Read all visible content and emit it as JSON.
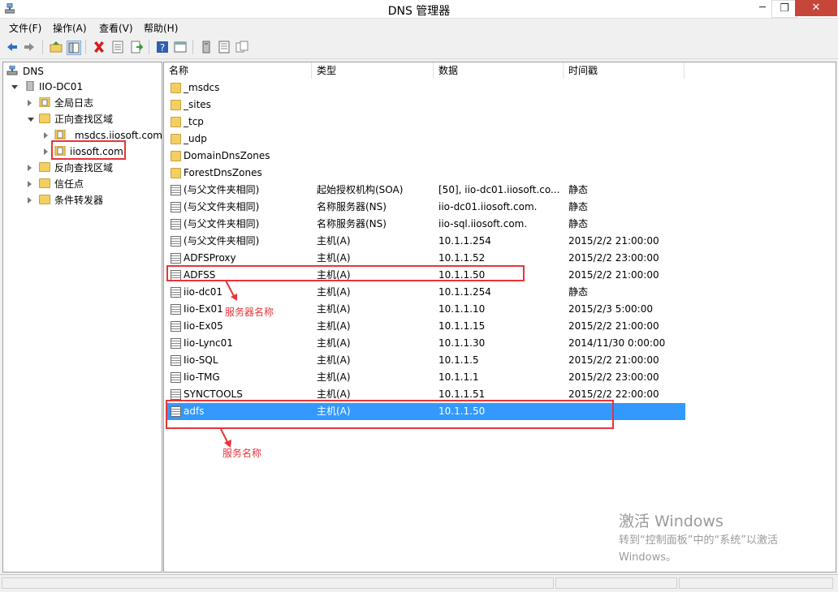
{
  "window": {
    "title": "DNS 管理器",
    "minimize": "─",
    "maximize": "❐",
    "close": "✕"
  },
  "menu": [
    "文件(F)",
    "操作(A)",
    "查看(V)",
    "帮助(H)"
  ],
  "toolbar_icons": [
    "back-icon",
    "forward-icon",
    "up-folder-icon",
    "show-hide-tree-icon",
    "delete-icon",
    "properties-icon",
    "export-icon",
    "help-icon",
    "console-icon",
    "server-icon",
    "record-list-icon",
    "copy-icon"
  ],
  "tree": {
    "root": "DNS",
    "server": "IIO-DC01",
    "items": [
      {
        "label": "全局日志",
        "level": 2,
        "expander": "closed"
      },
      {
        "label": "正向查找区域",
        "level": 2,
        "expander": "open"
      },
      {
        "label": "_msdcs.iiosoft.com",
        "level": 3,
        "expander": "closed"
      },
      {
        "label": "iiosoft.com",
        "level": 3,
        "expander": "closed"
      },
      {
        "label": "反向查找区域",
        "level": 2,
        "expander": "closed"
      },
      {
        "label": "信任点",
        "level": 2,
        "expander": "closed"
      },
      {
        "label": "条件转发器",
        "level": 2,
        "expander": "closed"
      }
    ]
  },
  "columns": [
    "名称",
    "类型",
    "数据",
    "时间戳"
  ],
  "rows": [
    {
      "name": "_msdcs",
      "type": "",
      "data": "",
      "timestamp": "",
      "icon": "folder-icon"
    },
    {
      "name": "_sites",
      "type": "",
      "data": "",
      "timestamp": "",
      "icon": "folder-icon"
    },
    {
      "name": "_tcp",
      "type": "",
      "data": "",
      "timestamp": "",
      "icon": "folder-icon"
    },
    {
      "name": "_udp",
      "type": "",
      "data": "",
      "timestamp": "",
      "icon": "folder-icon"
    },
    {
      "name": "DomainDnsZones",
      "type": "",
      "data": "",
      "timestamp": "",
      "icon": "folder-icon"
    },
    {
      "name": "ForestDnsZones",
      "type": "",
      "data": "",
      "timestamp": "",
      "icon": "folder-icon"
    },
    {
      "name": "(与父文件夹相同)",
      "type": "起始授权机构(SOA)",
      "data": "[50], iio-dc01.iiosoft.co...",
      "timestamp": "静态",
      "icon": "record-icon"
    },
    {
      "name": "(与父文件夹相同)",
      "type": "名称服务器(NS)",
      "data": "iio-dc01.iiosoft.com.",
      "timestamp": "静态",
      "icon": "record-icon"
    },
    {
      "name": "(与父文件夹相同)",
      "type": "名称服务器(NS)",
      "data": "iio-sql.iiosoft.com.",
      "timestamp": "静态",
      "icon": "record-icon"
    },
    {
      "name": "(与父文件夹相同)",
      "type": "主机(A)",
      "data": "10.1.1.254",
      "timestamp": "2015/2/2 21:00:00",
      "icon": "record-icon"
    },
    {
      "name": "ADFSProxy",
      "type": "主机(A)",
      "data": "10.1.1.52",
      "timestamp": "2015/2/2 23:00:00",
      "icon": "record-icon"
    },
    {
      "name": "ADFSS",
      "type": "主机(A)",
      "data": "10.1.1.50",
      "timestamp": "2015/2/2 21:00:00",
      "icon": "record-icon"
    },
    {
      "name": "iio-dc01",
      "type": "主机(A)",
      "data": "10.1.1.254",
      "timestamp": "静态",
      "icon": "record-icon"
    },
    {
      "name": "Iio-Ex01",
      "type": "主机(A)",
      "data": "10.1.1.10",
      "timestamp": "2015/2/3 5:00:00",
      "icon": "record-icon"
    },
    {
      "name": "Iio-Ex05",
      "type": "主机(A)",
      "data": "10.1.1.15",
      "timestamp": "2015/2/2 21:00:00",
      "icon": "record-icon"
    },
    {
      "name": "Iio-Lync01",
      "type": "主机(A)",
      "data": "10.1.1.30",
      "timestamp": "2014/11/30 0:00:00",
      "icon": "record-icon"
    },
    {
      "name": "Iio-SQL",
      "type": "主机(A)",
      "data": "10.1.1.5",
      "timestamp": "2015/2/2 21:00:00",
      "icon": "record-icon"
    },
    {
      "name": "Iio-TMG",
      "type": "主机(A)",
      "data": "10.1.1.1",
      "timestamp": "2015/2/2 23:00:00",
      "icon": "record-icon"
    },
    {
      "name": "SYNCTOOLS",
      "type": "主机(A)",
      "data": "10.1.1.51",
      "timestamp": "2015/2/2 22:00:00",
      "icon": "record-icon"
    },
    {
      "name": "adfs",
      "type": "主机(A)",
      "data": "10.1.1.50",
      "timestamp": "",
      "icon": "record-icon",
      "selected": true
    }
  ],
  "annotations": {
    "server_name": "服务器名称",
    "service_name": "服务名称"
  },
  "watermark": {
    "line1": "激活 Windows",
    "line2": "转到“控制面板”中的“系统”以激活",
    "line3": "Windows。"
  },
  "colors": {
    "selection": "#3399ff",
    "annotation": "#e8343a",
    "close_button": "#c7463a"
  }
}
